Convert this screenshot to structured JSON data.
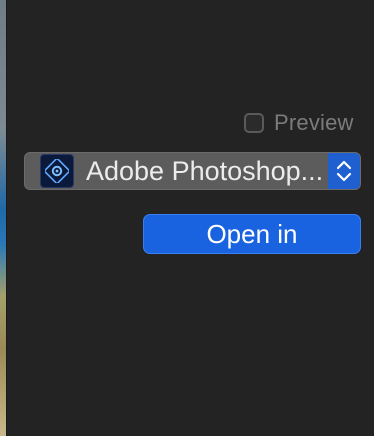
{
  "preview": {
    "label": "Preview",
    "checked": false
  },
  "app_selector": {
    "selected_app": "Adobe Photoshop...",
    "icon": "photoshop-elements-icon",
    "stepper_icon": "up-down-chevron-icon"
  },
  "open_button": {
    "label": "Open in"
  },
  "colors": {
    "background": "#232323",
    "accent": "#1a63e0",
    "popup_bg": "#5c5c5c",
    "muted_text": "#7b7b7b"
  }
}
